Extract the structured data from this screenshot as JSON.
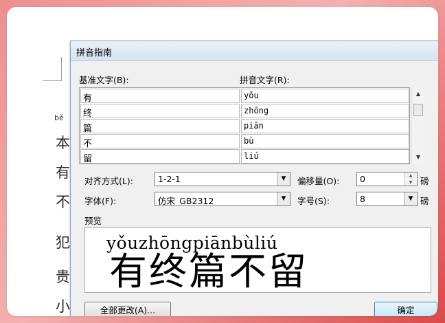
{
  "document": {
    "pinyin_label": "bě",
    "chars": [
      "本",
      "有",
      "不",
      "犯",
      "贵",
      "小"
    ]
  },
  "dialog": {
    "title": "拼音指南",
    "base_text_label": "基准文字(B):",
    "pinyin_text_label": "拼音文字(R):",
    "rows": [
      {
        "base": "有",
        "pinyin": "yǒu"
      },
      {
        "base": "终",
        "pinyin": "zhōng"
      },
      {
        "base": "篇",
        "pinyin": "piān"
      },
      {
        "base": "不",
        "pinyin": "bù"
      },
      {
        "base": "留",
        "pinyin": "liú"
      }
    ],
    "alignment_label": "对齐方式(L):",
    "alignment_value": "1-2-1",
    "offset_label": "偏移量(O):",
    "offset_value": "0",
    "offset_unit": "磅",
    "font_label": "字体(F):",
    "font_value": "仿宋_GB2312",
    "size_label": "字号(S):",
    "size_value": "8",
    "size_unit": "磅",
    "preview_label": "预览",
    "preview_pinyin": "yǒuzhōngpiānbùliú",
    "preview_chars": "有终篇不留",
    "change_all_button": "全部更改(A)...",
    "ok_button": "确定"
  }
}
